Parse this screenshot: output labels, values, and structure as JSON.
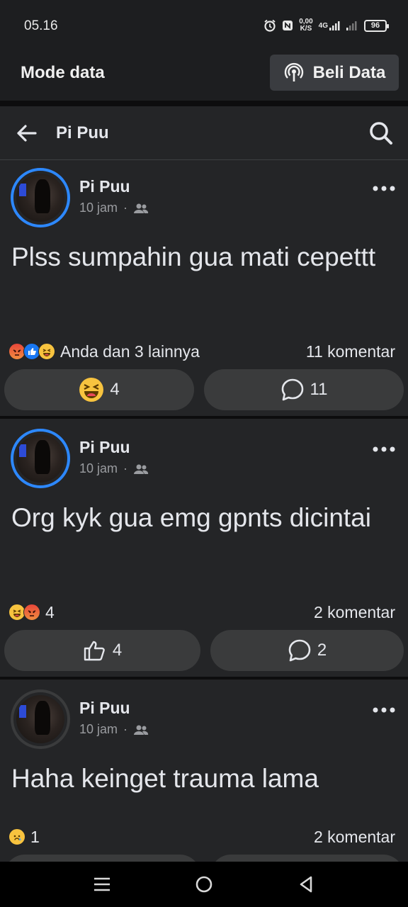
{
  "status_bar": {
    "time": "05.16",
    "speed_value": "0,00",
    "speed_unit": "K/S",
    "network": "4G",
    "battery": "96"
  },
  "mode_bar": {
    "label": "Mode data",
    "buy_button": "Beli Data"
  },
  "header": {
    "title": "Pi Puu"
  },
  "posts": [
    {
      "author": "Pi Puu",
      "time": "10 jam",
      "separator": "·",
      "text": "Plss sumpahin gua mati cepettt",
      "reactions_text": "Anda dan 3 lainnya",
      "comments_text": "11 komentar",
      "reaction_count": "4",
      "comment_count": "11"
    },
    {
      "author": "Pi Puu",
      "time": "10 jam",
      "separator": "·",
      "text": "Org kyk gua emg gpnts dicintai",
      "reactions_text": "4",
      "comments_text": "2 komentar",
      "reaction_count": "4",
      "comment_count": "2"
    },
    {
      "author": "Pi Puu",
      "time": "10 jam",
      "separator": "·",
      "text": "Haha keinget trauma lama",
      "reactions_text": "1",
      "comments_text": "2 komentar"
    }
  ],
  "colors": {
    "background": "#242527",
    "accent": "#2d88ff",
    "button": "#3a3b3c",
    "text": "#e4e6eb",
    "muted": "#9a9ca0"
  }
}
